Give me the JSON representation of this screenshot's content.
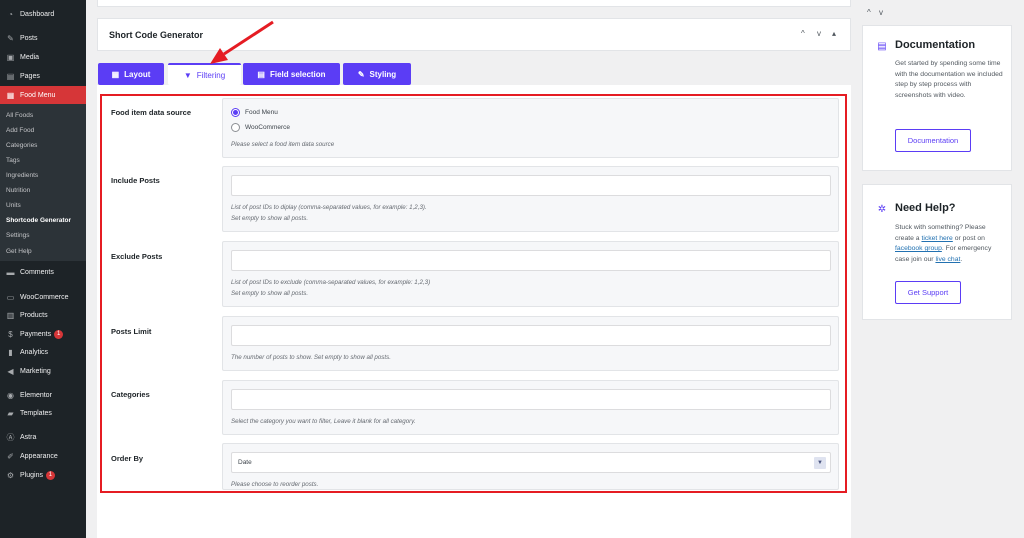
{
  "sidebar": {
    "top_items": [
      {
        "label": "Dashboard",
        "icon": "dashboard-icon"
      },
      {
        "label": "Posts",
        "icon": "pin-icon"
      },
      {
        "label": "Media",
        "icon": "media-icon"
      },
      {
        "label": "Pages",
        "icon": "pages-icon"
      },
      {
        "label": "Food Menu",
        "icon": "food-menu-icon"
      }
    ],
    "sub_items": [
      "All Foods",
      "Add Food",
      "Categories",
      "Tags",
      "Ingredients",
      "Nutrition",
      "Units",
      "Shortcode Generator",
      "Settings",
      "Get Help"
    ],
    "bottom_items": [
      {
        "label": "Comments",
        "icon": "comments-icon"
      },
      {
        "label": "WooCommerce",
        "icon": "woocommerce-icon"
      },
      {
        "label": "Products",
        "icon": "products-icon"
      },
      {
        "label": "Payments",
        "icon": "payments-icon",
        "badge": "1"
      },
      {
        "label": "Analytics",
        "icon": "analytics-icon"
      },
      {
        "label": "Marketing",
        "icon": "marketing-icon"
      },
      {
        "label": "Elementor",
        "icon": "elementor-icon"
      },
      {
        "label": "Templates",
        "icon": "templates-icon"
      },
      {
        "label": "Astra",
        "icon": "astra-icon"
      },
      {
        "label": "Appearance",
        "icon": "appearance-icon"
      },
      {
        "label": "Plugins",
        "icon": "plugins-icon",
        "badge": "1"
      }
    ]
  },
  "header": {
    "title": "Short Code Generator",
    "controls": [
      "^",
      "v",
      "▴"
    ]
  },
  "tabs": [
    {
      "label": "Layout",
      "icon": "layout-icon"
    },
    {
      "label": "Filtering",
      "icon": "filter-icon"
    },
    {
      "label": "Field selection",
      "icon": "field-selection-icon"
    },
    {
      "label": "Styling",
      "icon": "brush-icon"
    }
  ],
  "form": {
    "data_source": {
      "label": "Food item data source",
      "options": [
        "Food Menu",
        "WooCommerce"
      ],
      "selected": "Food Menu",
      "hint": "Please select a food item data source"
    },
    "include_posts": {
      "label": "Include Posts",
      "value": "",
      "hint_1": "List of post IDs to diplay (comma-separated values, for example: 1,2,3).",
      "hint_2": "Set empty to show all posts."
    },
    "exclude_posts": {
      "label": "Exclude Posts",
      "value": "",
      "hint_1": "List of post IDs to exclude (comma-separated values, for example: 1,2,3)",
      "hint_2": "Set empty to show all posts."
    },
    "posts_limit": {
      "label": "Posts Limit",
      "value": "",
      "hint": "The number of posts to show. Set empty to show all posts."
    },
    "categories": {
      "label": "Categories",
      "value": "",
      "hint": "Select the category you want to filter, Leave it blank for all category."
    },
    "order_by": {
      "label": "Order By",
      "value": "Date",
      "hint": "Please choose to reorder posts."
    }
  },
  "right": {
    "controls": "^ v",
    "documentation": {
      "title": "Documentation",
      "text": "Get started by spending some time with the documentation we included step by step process with screenshots with video.",
      "button": "Documentation"
    },
    "help": {
      "title": "Need Help?",
      "text_1": "Stuck with something? Please create a ",
      "link_1": "ticket here",
      "text_2": " or post on ",
      "link_2": "facebook group",
      "text_3": ". For emergency case join our ",
      "link_3": "live chat",
      "text_4": ".",
      "button": "Get Support"
    }
  },
  "colors": {
    "accent": "#5b3df5",
    "sidebar_bg": "#1d2327",
    "active_menu": "#d63638",
    "highlight_border": "#e51c23"
  }
}
